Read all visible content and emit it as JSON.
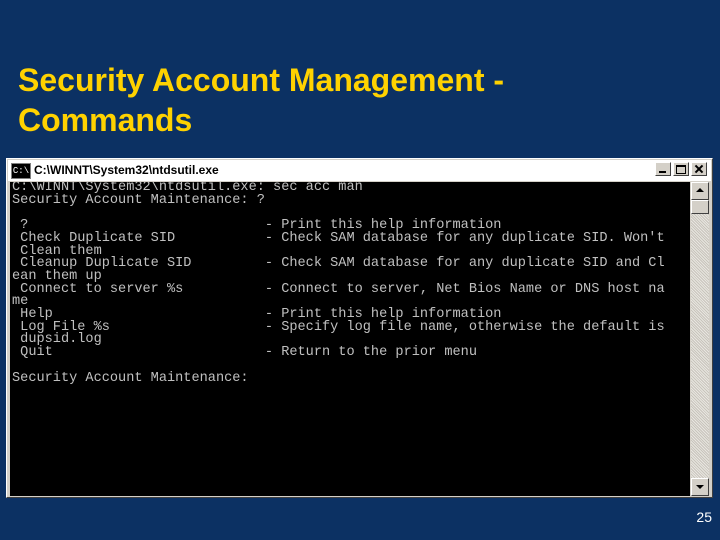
{
  "slide": {
    "title_line1": "Security Account Management -",
    "title_line2": "Commands",
    "page_number": "25"
  },
  "window": {
    "title": "C:\\WINNT\\System32\\ntdsutil.exe",
    "icon_label": "C:\\"
  },
  "console": {
    "lines": [
      "C:\\WINNT\\System32\\ntdsutil.exe: sec acc man",
      "Security Account Maintenance: ?",
      "",
      " ?                             - Print this help information",
      " Check Duplicate SID           - Check SAM database for any duplicate SID. Won't",
      " Clean them",
      " Cleanup Duplicate SID         - Check SAM database for any duplicate SID and Cl",
      "ean them up",
      " Connect to server %s          - Connect to server, Net Bios Name or DNS host na",
      "me",
      " Help                          - Print this help information",
      " Log File %s                   - Specify log file name, otherwise the default is",
      " dupsid.log",
      " Quit                          - Return to the prior menu",
      "",
      "Security Account Maintenance:"
    ]
  }
}
